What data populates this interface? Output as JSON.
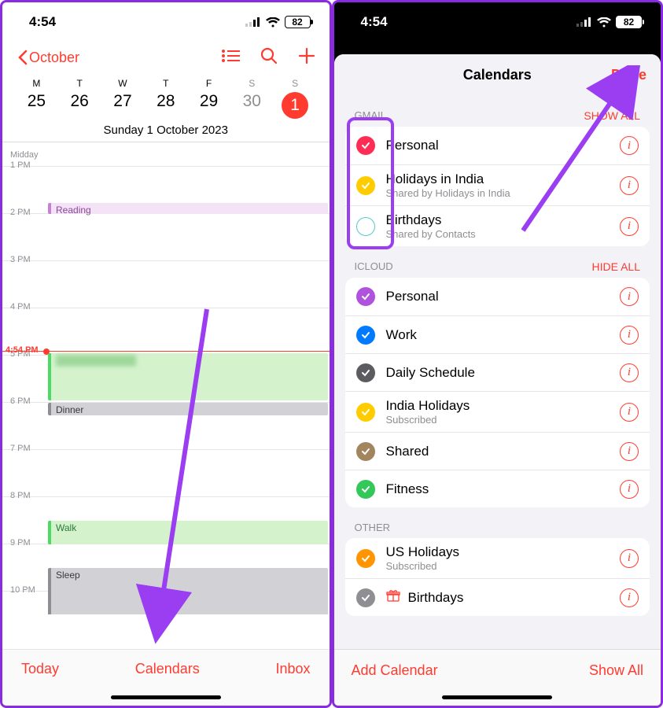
{
  "left": {
    "status_time": "4:54",
    "battery": "82",
    "nav_back": "October",
    "weekdays": [
      "M",
      "T",
      "W",
      "T",
      "F",
      "S",
      "S"
    ],
    "dates": [
      "25",
      "26",
      "27",
      "28",
      "29",
      "30",
      "1"
    ],
    "dateline": "Sunday  1 October 2023",
    "midday": "Midday",
    "hours": [
      "1 PM",
      "2 PM",
      "3 PM",
      "4 PM",
      "5 PM",
      "6 PM",
      "7 PM",
      "8 PM",
      "9 PM",
      "10 PM"
    ],
    "now_label": "4:54 PM",
    "events": {
      "reading": "Reading",
      "dinner": "Dinner",
      "walk": "Walk",
      "sleep": "Sleep"
    },
    "toolbar": {
      "today": "Today",
      "calendars": "Calendars",
      "inbox": "Inbox"
    }
  },
  "right": {
    "status_time": "4:54",
    "battery": "82",
    "sheet_title": "Calendars",
    "done": "Done",
    "sections": {
      "gmail": {
        "header": "GMAIL",
        "action": "SHOW ALL",
        "items": [
          {
            "color": "#ff2d55",
            "checked": true,
            "title": "Personal",
            "sub": ""
          },
          {
            "color": "#ffcc00",
            "checked": true,
            "title": "Holidays in India",
            "sub": "Shared by Holidays in India"
          },
          {
            "color": "#5ac8c8",
            "checked": false,
            "title": "Birthdays",
            "sub": "Shared by Contacts"
          }
        ]
      },
      "icloud": {
        "header": "ICLOUD",
        "action": "HIDE ALL",
        "items": [
          {
            "color": "#af52de",
            "checked": true,
            "title": "Personal",
            "sub": ""
          },
          {
            "color": "#007aff",
            "checked": true,
            "title": "Work",
            "sub": ""
          },
          {
            "color": "#5b5b60",
            "checked": true,
            "title": "Daily Schedule",
            "sub": ""
          },
          {
            "color": "#ffcc00",
            "checked": true,
            "title": "India Holidays",
            "sub": "Subscribed"
          },
          {
            "color": "#a2845e",
            "checked": true,
            "title": "Shared",
            "sub": ""
          },
          {
            "color": "#34c759",
            "checked": true,
            "title": "Fitness",
            "sub": ""
          }
        ]
      },
      "other": {
        "header": "OTHER",
        "action": "",
        "items": [
          {
            "color": "#ff9500",
            "checked": true,
            "title": "US Holidays",
            "sub": "Subscribed"
          },
          {
            "color": "#8e8e93",
            "checked": true,
            "title": "Birthdays",
            "sub": "",
            "gift": true
          }
        ]
      }
    },
    "toolbar": {
      "add": "Add Calendar",
      "showall": "Show All"
    }
  }
}
